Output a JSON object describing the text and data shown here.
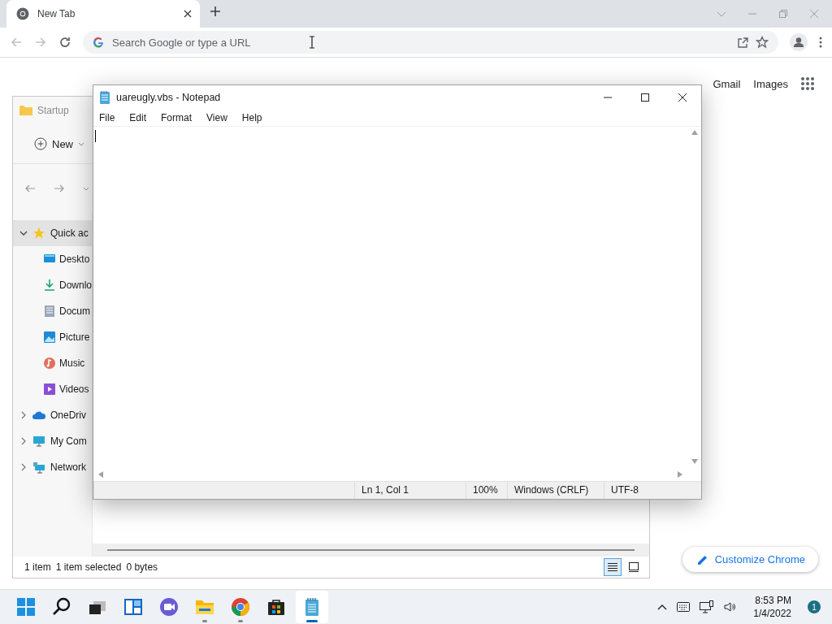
{
  "browser": {
    "tabs": [
      {
        "label": "New Tab",
        "selected": true
      }
    ],
    "omnibox": {
      "placeholder": "Search Google or type a URL"
    },
    "links": [
      "Gmail",
      "Images"
    ],
    "customize_button": "Customize Chrome"
  },
  "explorer": {
    "title": "Startup",
    "new_button": "New",
    "nav_items": [
      {
        "label": "Quick ac",
        "expanded": true,
        "selected": true,
        "children": [
          {
            "label": "Deskto",
            "kind": "desktop"
          },
          {
            "label": "Downlo",
            "kind": "downloads"
          },
          {
            "label": "Docum",
            "kind": "documents"
          },
          {
            "label": "Picture",
            "kind": "pictures"
          },
          {
            "label": "Music",
            "kind": "music"
          },
          {
            "label": "Videos",
            "kind": "videos"
          }
        ]
      },
      {
        "label": "OneDriv",
        "kind": "cloud",
        "expanded": false,
        "selected": false
      },
      {
        "label": "My Com",
        "kind": "computer",
        "expanded": false,
        "selected": false
      },
      {
        "label": "Network",
        "kind": "network",
        "expanded": false,
        "selected": false
      }
    ],
    "status": [
      "1 item",
      "1 item selected",
      "0 bytes"
    ],
    "views": [
      {
        "kind": "details",
        "selected": true
      },
      {
        "kind": "preview",
        "selected": false
      }
    ]
  },
  "notepad": {
    "title": "uareugly.vbs - Notepad",
    "menu": [
      "File",
      "Edit",
      "Format",
      "View",
      "Help"
    ],
    "status": [
      "Ln 1, Col 1",
      "100%",
      "Windows (CRLF)",
      "UTF-8"
    ]
  },
  "taskbar": {
    "apps": [
      {
        "kind": "start",
        "running": false,
        "selected": false
      },
      {
        "kind": "search",
        "running": false,
        "selected": false
      },
      {
        "kind": "taskview",
        "running": false,
        "selected": false
      },
      {
        "kind": "widgets",
        "running": false,
        "selected": false
      },
      {
        "kind": "chat",
        "running": false,
        "selected": false
      },
      {
        "kind": "explorer",
        "running": true,
        "selected": false
      },
      {
        "kind": "chrome",
        "running": true,
        "selected": false
      },
      {
        "kind": "store",
        "running": false,
        "selected": false
      },
      {
        "kind": "notepad",
        "running": true,
        "selected": true
      }
    ],
    "time": "8:53 PM",
    "date": "1/4/2022",
    "notification_count": "1"
  }
}
